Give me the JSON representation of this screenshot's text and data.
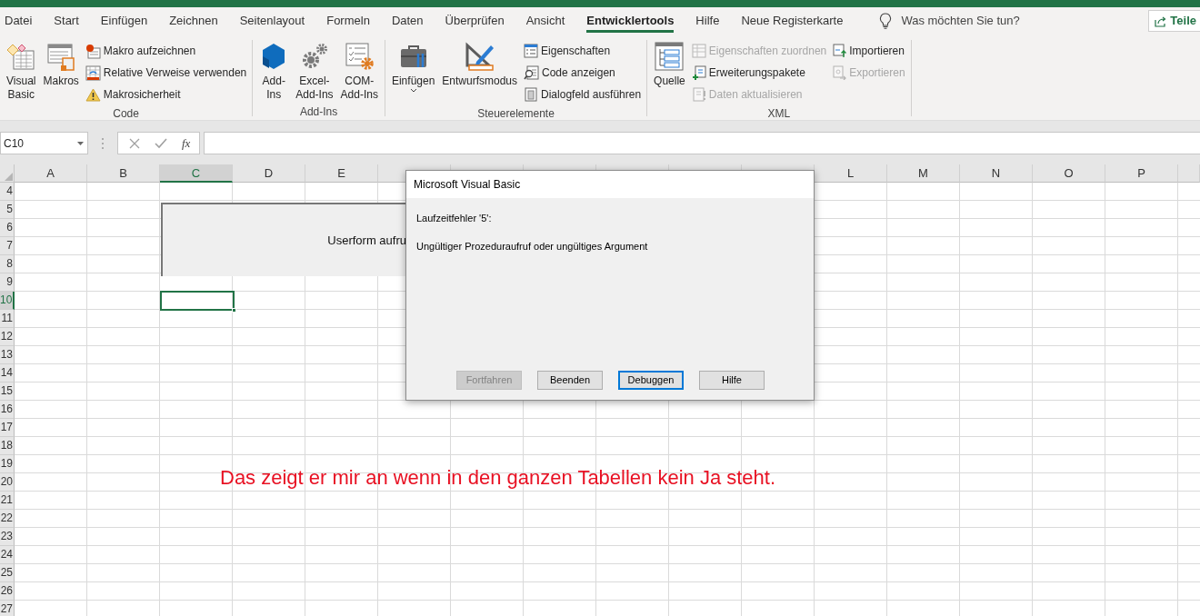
{
  "tabs": [
    {
      "label": "Datei",
      "selected": false
    },
    {
      "label": "Start",
      "selected": false
    },
    {
      "label": "Einfügen",
      "selected": false
    },
    {
      "label": "Zeichnen",
      "selected": false
    },
    {
      "label": "Seitenlayout",
      "selected": false
    },
    {
      "label": "Formeln",
      "selected": false
    },
    {
      "label": "Daten",
      "selected": false
    },
    {
      "label": "Überprüfen",
      "selected": false
    },
    {
      "label": "Ansicht",
      "selected": false
    },
    {
      "label": "Entwicklertools",
      "selected": true
    },
    {
      "label": "Hilfe",
      "selected": false
    },
    {
      "label": "Neue Registerkarte",
      "selected": false
    }
  ],
  "tell_me": {
    "placeholder": "Was möchten Sie tun?"
  },
  "share_button": "Teile",
  "ribbon_groups": [
    {
      "label": "Code",
      "columns": [
        [
          {
            "kind": "large",
            "label": "Visual\nBasic",
            "disabled": false,
            "dropdown": false
          }
        ],
        [
          {
            "kind": "large",
            "label": "Makros",
            "disabled": false,
            "dropdown": false
          }
        ],
        [
          {
            "kind": "small",
            "label": "Makro aufzeichnen",
            "disabled": false
          },
          {
            "kind": "small",
            "label": "Relative Verweise verwenden",
            "disabled": false
          },
          {
            "kind": "small",
            "label": "Makrosicherheit",
            "disabled": false
          }
        ]
      ]
    },
    {
      "label": "Add-Ins",
      "columns": [
        [
          {
            "kind": "large",
            "label": "Add-\nIns",
            "disabled": false,
            "dropdown": false
          }
        ],
        [
          {
            "kind": "large",
            "label": "Excel-\nAdd-Ins",
            "disabled": false,
            "dropdown": false
          }
        ],
        [
          {
            "kind": "large",
            "label": "COM-\nAdd-Ins",
            "disabled": false,
            "dropdown": false
          }
        ]
      ]
    },
    {
      "label": "Steuerelemente",
      "columns": [
        [
          {
            "kind": "large",
            "label": "Einfügen",
            "disabled": false,
            "dropdown": true
          }
        ],
        [
          {
            "kind": "large",
            "label": "Entwurfsmodus",
            "disabled": false,
            "dropdown": false
          }
        ],
        [
          {
            "kind": "small",
            "label": "Eigenschaften",
            "disabled": false
          },
          {
            "kind": "small",
            "label": "Code anzeigen",
            "disabled": false
          },
          {
            "kind": "small",
            "label": "Dialogfeld ausführen",
            "disabled": false
          }
        ]
      ]
    },
    {
      "label": "XML",
      "columns": [
        [
          {
            "kind": "large",
            "label": "Quelle",
            "disabled": false,
            "dropdown": false
          }
        ],
        [
          {
            "kind": "small",
            "label": "Eigenschaften zuordnen",
            "disabled": true
          },
          {
            "kind": "small",
            "label": "Erweiterungspakete",
            "disabled": false
          },
          {
            "kind": "small",
            "label": "Daten aktualisieren",
            "disabled": true
          }
        ],
        [
          {
            "kind": "small",
            "label": "Importieren",
            "disabled": false
          },
          {
            "kind": "small",
            "label": "Exportieren",
            "disabled": true
          }
        ]
      ]
    }
  ],
  "formula_bar": {
    "name_box": "C10",
    "function_button": "fx"
  },
  "column_headers": {
    "left": [
      {
        "label": "A",
        "selected": false
      },
      {
        "label": "B",
        "selected": false
      },
      {
        "label": "C",
        "selected": true
      },
      {
        "label": "D",
        "selected": false
      },
      {
        "label": "E",
        "selected": false
      }
    ],
    "right": [
      {
        "label": "L",
        "selected": false
      },
      {
        "label": "M",
        "selected": false
      },
      {
        "label": "N",
        "selected": false
      },
      {
        "label": "O",
        "selected": false
      },
      {
        "label": "P",
        "selected": false
      }
    ]
  },
  "row_headers": [
    {
      "label": "4",
      "selected": false
    },
    {
      "label": "5",
      "selected": false
    },
    {
      "label": "6",
      "selected": false
    },
    {
      "label": "7",
      "selected": false
    },
    {
      "label": "8",
      "selected": false
    },
    {
      "label": "9",
      "selected": false
    },
    {
      "label": "10",
      "selected": true
    },
    {
      "label": "11",
      "selected": false
    },
    {
      "label": "12",
      "selected": false
    },
    {
      "label": "13",
      "selected": false
    },
    {
      "label": "14",
      "selected": false
    },
    {
      "label": "15",
      "selected": false
    },
    {
      "label": "16",
      "selected": false
    },
    {
      "label": "17",
      "selected": false
    },
    {
      "label": "18",
      "selected": false
    },
    {
      "label": "19",
      "selected": false
    },
    {
      "label": "20",
      "selected": false
    },
    {
      "label": "21",
      "selected": false
    },
    {
      "label": "22",
      "selected": false
    },
    {
      "label": "23",
      "selected": false
    },
    {
      "label": "24",
      "selected": false
    },
    {
      "label": "25",
      "selected": false
    },
    {
      "label": "26",
      "selected": false
    },
    {
      "label": "27",
      "selected": false
    }
  ],
  "shape_button": {
    "label": "Userform aufru"
  },
  "dialog": {
    "title": "Microsoft Visual Basic",
    "messages": [
      "Laufzeitfehler '5':",
      "Ungültiger Prozeduraufruf oder ungültiges Argument"
    ],
    "buttons": [
      {
        "label": "Fortfahren",
        "disabled": true,
        "focused": false
      },
      {
        "label": "Beenden",
        "disabled": false,
        "focused": false
      },
      {
        "label": "Debuggen",
        "disabled": false,
        "focused": true
      },
      {
        "label": "Hilfe",
        "disabled": false,
        "focused": false
      }
    ]
  },
  "annotation": "Das zeigt er mir an wenn in den ganzen Tabellen kein Ja steht."
}
